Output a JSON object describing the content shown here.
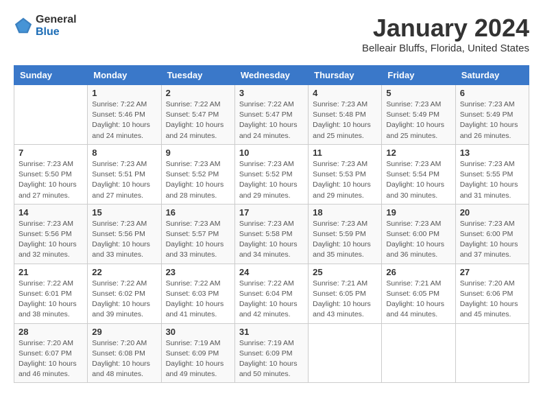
{
  "header": {
    "logo_general": "General",
    "logo_blue": "Blue",
    "title": "January 2024",
    "subtitle": "Belleair Bluffs, Florida, United States"
  },
  "days_of_week": [
    "Sunday",
    "Monday",
    "Tuesday",
    "Wednesday",
    "Thursday",
    "Friday",
    "Saturday"
  ],
  "weeks": [
    [
      {
        "day": "",
        "info": ""
      },
      {
        "day": "1",
        "info": "Sunrise: 7:22 AM\nSunset: 5:46 PM\nDaylight: 10 hours\nand 24 minutes."
      },
      {
        "day": "2",
        "info": "Sunrise: 7:22 AM\nSunset: 5:47 PM\nDaylight: 10 hours\nand 24 minutes."
      },
      {
        "day": "3",
        "info": "Sunrise: 7:22 AM\nSunset: 5:47 PM\nDaylight: 10 hours\nand 24 minutes."
      },
      {
        "day": "4",
        "info": "Sunrise: 7:23 AM\nSunset: 5:48 PM\nDaylight: 10 hours\nand 25 minutes."
      },
      {
        "day": "5",
        "info": "Sunrise: 7:23 AM\nSunset: 5:49 PM\nDaylight: 10 hours\nand 25 minutes."
      },
      {
        "day": "6",
        "info": "Sunrise: 7:23 AM\nSunset: 5:49 PM\nDaylight: 10 hours\nand 26 minutes."
      }
    ],
    [
      {
        "day": "7",
        "info": "Sunrise: 7:23 AM\nSunset: 5:50 PM\nDaylight: 10 hours\nand 27 minutes."
      },
      {
        "day": "8",
        "info": "Sunrise: 7:23 AM\nSunset: 5:51 PM\nDaylight: 10 hours\nand 27 minutes."
      },
      {
        "day": "9",
        "info": "Sunrise: 7:23 AM\nSunset: 5:52 PM\nDaylight: 10 hours\nand 28 minutes."
      },
      {
        "day": "10",
        "info": "Sunrise: 7:23 AM\nSunset: 5:52 PM\nDaylight: 10 hours\nand 29 minutes."
      },
      {
        "day": "11",
        "info": "Sunrise: 7:23 AM\nSunset: 5:53 PM\nDaylight: 10 hours\nand 29 minutes."
      },
      {
        "day": "12",
        "info": "Sunrise: 7:23 AM\nSunset: 5:54 PM\nDaylight: 10 hours\nand 30 minutes."
      },
      {
        "day": "13",
        "info": "Sunrise: 7:23 AM\nSunset: 5:55 PM\nDaylight: 10 hours\nand 31 minutes."
      }
    ],
    [
      {
        "day": "14",
        "info": "Sunrise: 7:23 AM\nSunset: 5:56 PM\nDaylight: 10 hours\nand 32 minutes."
      },
      {
        "day": "15",
        "info": "Sunrise: 7:23 AM\nSunset: 5:56 PM\nDaylight: 10 hours\nand 33 minutes."
      },
      {
        "day": "16",
        "info": "Sunrise: 7:23 AM\nSunset: 5:57 PM\nDaylight: 10 hours\nand 33 minutes."
      },
      {
        "day": "17",
        "info": "Sunrise: 7:23 AM\nSunset: 5:58 PM\nDaylight: 10 hours\nand 34 minutes."
      },
      {
        "day": "18",
        "info": "Sunrise: 7:23 AM\nSunset: 5:59 PM\nDaylight: 10 hours\nand 35 minutes."
      },
      {
        "day": "19",
        "info": "Sunrise: 7:23 AM\nSunset: 6:00 PM\nDaylight: 10 hours\nand 36 minutes."
      },
      {
        "day": "20",
        "info": "Sunrise: 7:23 AM\nSunset: 6:00 PM\nDaylight: 10 hours\nand 37 minutes."
      }
    ],
    [
      {
        "day": "21",
        "info": "Sunrise: 7:22 AM\nSunset: 6:01 PM\nDaylight: 10 hours\nand 38 minutes."
      },
      {
        "day": "22",
        "info": "Sunrise: 7:22 AM\nSunset: 6:02 PM\nDaylight: 10 hours\nand 39 minutes."
      },
      {
        "day": "23",
        "info": "Sunrise: 7:22 AM\nSunset: 6:03 PM\nDaylight: 10 hours\nand 41 minutes."
      },
      {
        "day": "24",
        "info": "Sunrise: 7:22 AM\nSunset: 6:04 PM\nDaylight: 10 hours\nand 42 minutes."
      },
      {
        "day": "25",
        "info": "Sunrise: 7:21 AM\nSunset: 6:05 PM\nDaylight: 10 hours\nand 43 minutes."
      },
      {
        "day": "26",
        "info": "Sunrise: 7:21 AM\nSunset: 6:05 PM\nDaylight: 10 hours\nand 44 minutes."
      },
      {
        "day": "27",
        "info": "Sunrise: 7:20 AM\nSunset: 6:06 PM\nDaylight: 10 hours\nand 45 minutes."
      }
    ],
    [
      {
        "day": "28",
        "info": "Sunrise: 7:20 AM\nSunset: 6:07 PM\nDaylight: 10 hours\nand 46 minutes."
      },
      {
        "day": "29",
        "info": "Sunrise: 7:20 AM\nSunset: 6:08 PM\nDaylight: 10 hours\nand 48 minutes."
      },
      {
        "day": "30",
        "info": "Sunrise: 7:19 AM\nSunset: 6:09 PM\nDaylight: 10 hours\nand 49 minutes."
      },
      {
        "day": "31",
        "info": "Sunrise: 7:19 AM\nSunset: 6:09 PM\nDaylight: 10 hours\nand 50 minutes."
      },
      {
        "day": "",
        "info": ""
      },
      {
        "day": "",
        "info": ""
      },
      {
        "day": "",
        "info": ""
      }
    ]
  ]
}
